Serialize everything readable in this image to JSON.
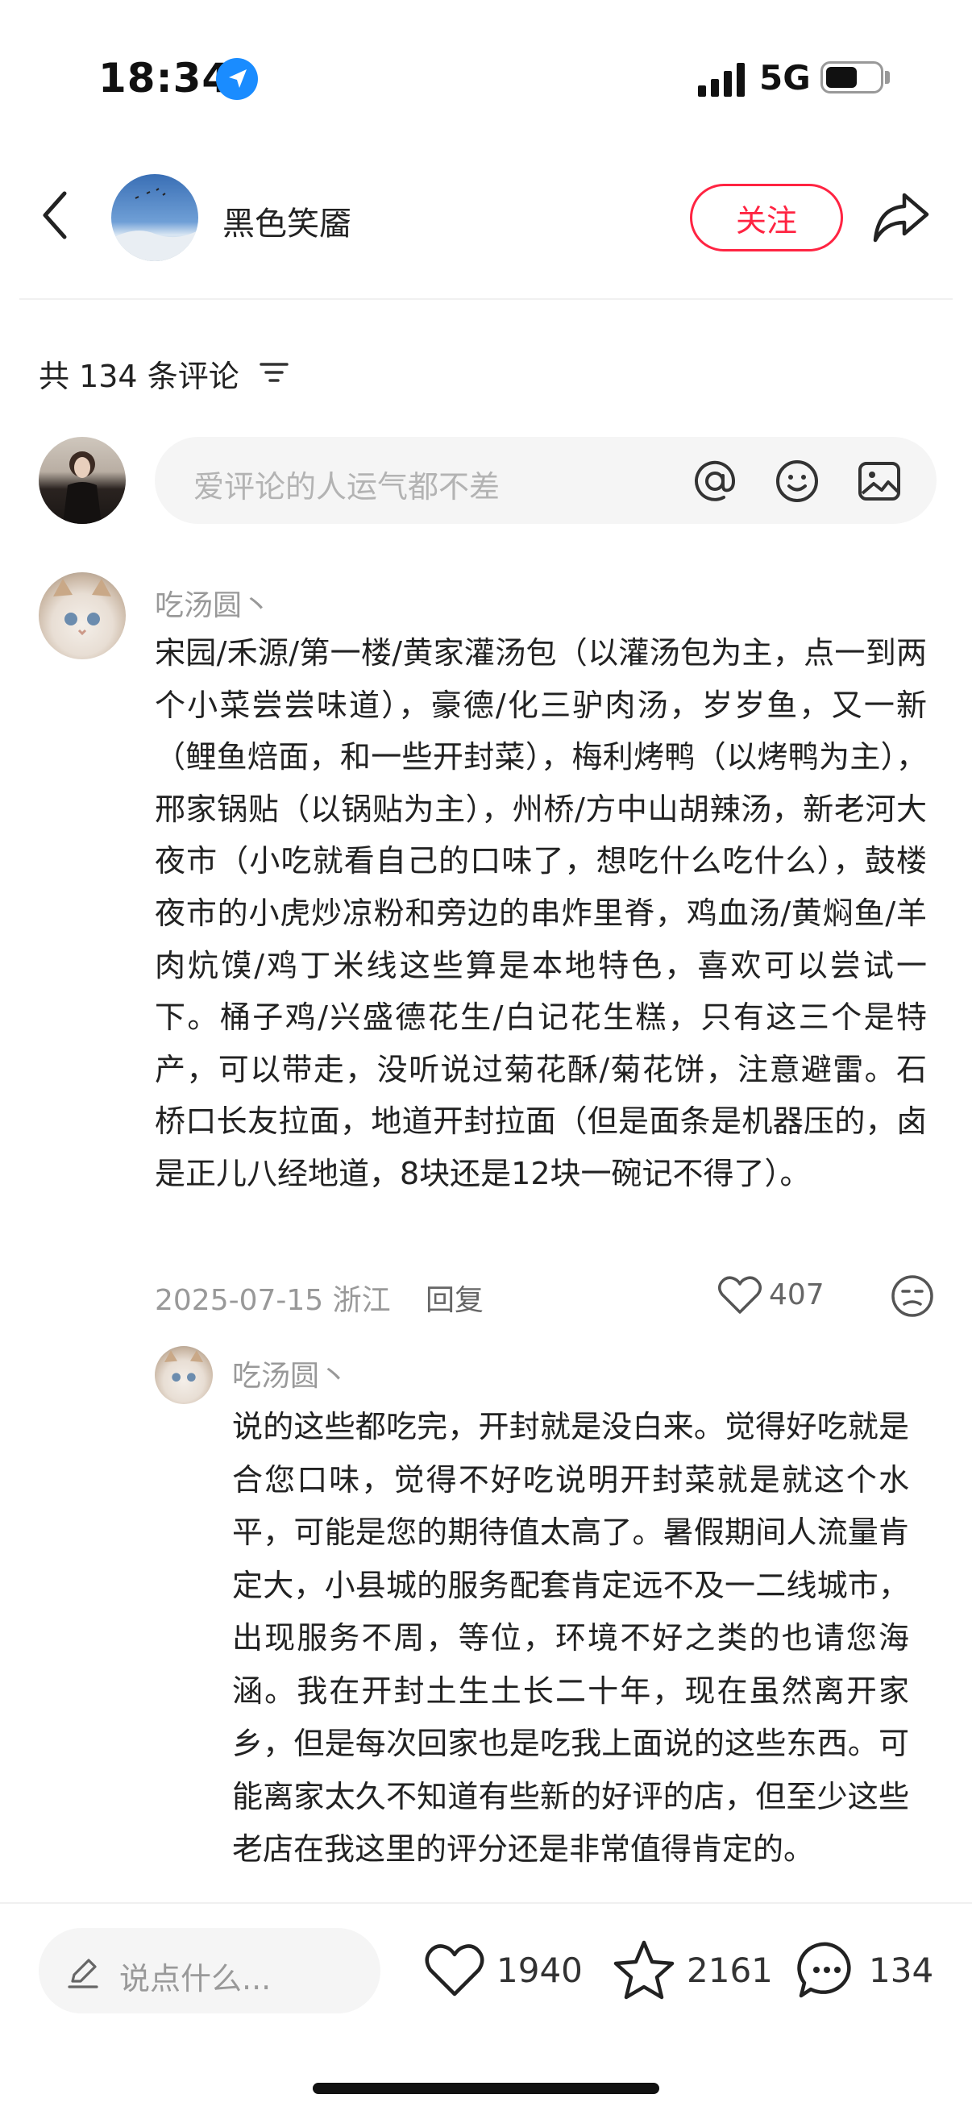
{
  "status_bar": {
    "time": "18:34",
    "network": "5G"
  },
  "header": {
    "author_name": "黑色笑靥",
    "follow_label": "关注"
  },
  "comments_header": {
    "count_text": "共 134 条评论"
  },
  "comment_input": {
    "placeholder": "爱评论的人运气都不差"
  },
  "comments": [
    {
      "user": "吃汤圆丶",
      "text": "宋园/禾源/第一楼/黄家灌汤包（以灌汤包为主，点一到两个小菜尝尝味道），豪德/化三驴肉汤，岁岁鱼，又一新（鲤鱼焙面，和一些开封菜），梅利烤鸭（以烤鸭为主），邢家锅贴（以锅贴为主），州桥/方中山胡辣汤，新老河大夜市（小吃就看自己的口味了，想吃什么吃什么），鼓楼夜市的小虎炒凉粉和旁边的串炸里脊，鸡血汤/黄焖鱼/羊肉炕馍/鸡丁米线这些算是本地特色，喜欢可以尝试一下。桶子鸡/兴盛德花生/白记花生糕，只有这三个是特产，可以带走，没听说过菊花酥/菊花饼，注意避雷。石桥口长友拉面，地道开封拉面（但是面条是机器压的，卤是正儿八经地道，8块还是12块一碗记不得了）。",
      "meta": "2025-07-15 浙江",
      "reply_label": "回复",
      "likes": "407",
      "replies": [
        {
          "user": "吃汤圆丶",
          "text": "说的这些都吃完，开封就是没白来。觉得好吃就是合您口味，觉得不好吃说明开封菜就是就这个水平，可能是您的期待值太高了。暑假期间人流量肯定大，小县城的服务配套肯定远不及一二线城市，出现服务不周，等位，环境不好之类的也请您海涵。我在开封土生土长二十年，现在虽然离开家乡，但是每次回家也是吃我上面说的这些东西。可能离家太久不知道有些新的好评的店，但至少这些老店在我这里的评分还是非常值得肯定的。"
        }
      ]
    }
  ],
  "bottom_bar": {
    "say_placeholder": "说点什么...",
    "likes": "1940",
    "favorites": "2161",
    "comments": "134"
  },
  "colors": {
    "accent": "#ff2442",
    "muted_text": "#999999",
    "pill_bg": "#f5f5f5"
  },
  "icons": [
    "location-arrow-icon",
    "signal-icon",
    "battery-icon",
    "back-icon",
    "share-icon",
    "filter-icon",
    "at-icon",
    "emoji-icon",
    "image-icon",
    "heart-icon",
    "dislike-icon",
    "pencil-icon",
    "star-icon",
    "comment-bubble-icon"
  ]
}
